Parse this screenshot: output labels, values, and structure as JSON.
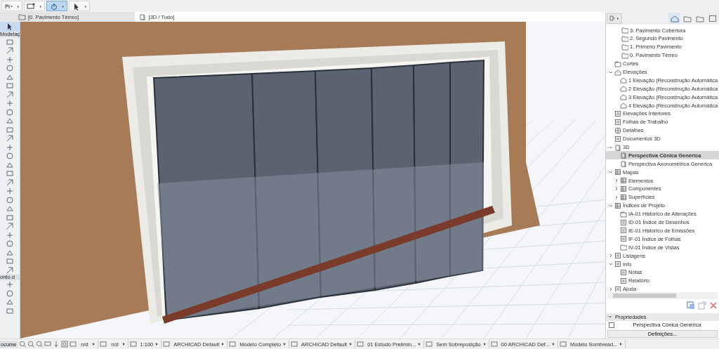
{
  "toolbar": {
    "buttons": [
      {
        "kind": "pet",
        "selected": false
      },
      {
        "kind": "layers",
        "selected": false
      },
      {
        "kind": "render",
        "selected": true
      },
      {
        "kind": "arrow",
        "selected": false
      }
    ]
  },
  "view_tabs": [
    {
      "label": "[0. Pavimento Térreo]",
      "kind": "plan",
      "selected": false
    },
    {
      "label": "[3D / Tudo]",
      "kind": "model",
      "selected": true
    }
  ],
  "toolbox": {
    "labels": [
      "Modelaç",
      "onto d"
    ]
  },
  "navigator": {
    "tree": [
      {
        "label": "3. Pavimento Cobertura",
        "kind": "story",
        "selected": false
      },
      {
        "label": "2. Segundo Pavimento",
        "kind": "story",
        "selected": false
      },
      {
        "label": "1. Primeiro Pavimento",
        "kind": "story",
        "selected": false
      },
      {
        "label": "0. Pavimento Térreo",
        "kind": "story",
        "selected": false
      },
      {
        "label": "Cortes",
        "kind": "section",
        "selected": false
      },
      {
        "label": "Elevações",
        "kind": "elevation",
        "selected": false,
        "expanded": true,
        "children": [
          {
            "label": "1 Elevação (Reconstrução Automática",
            "kind": "elevation",
            "selected": false
          },
          {
            "label": "2 Elevação (Reconstrução Automática",
            "kind": "elevation",
            "selected": false
          },
          {
            "label": "3 Elevação (Reconstrução Automática",
            "kind": "elevation",
            "selected": false
          },
          {
            "label": "4 Elevação (Reconstrução Automática",
            "kind": "elevation",
            "selected": false
          }
        ]
      },
      {
        "label": "Elevações Interiores",
        "kind": "sheet",
        "selected": false
      },
      {
        "label": "Folhas de Trabalho",
        "kind": "sheet",
        "selected": false
      },
      {
        "label": "Detalhes",
        "kind": "detail",
        "selected": false
      },
      {
        "label": "Documentos 3D",
        "kind": "sheet",
        "selected": false
      },
      {
        "label": "3D",
        "kind": "cube",
        "selected": false,
        "expanded": true,
        "children": [
          {
            "label": "Perspectiva Cônica Genérica",
            "kind": "cube",
            "selected": true
          },
          {
            "label": "Perspectiva Axonométrica Genérica",
            "kind": "cube",
            "selected": false
          }
        ]
      },
      {
        "label": "Mapas",
        "kind": "table",
        "selected": false,
        "expanded": true,
        "children": [
          {
            "label": "Elementos",
            "kind": "table",
            "selected": false,
            "expanded": false
          },
          {
            "label": "Componentes",
            "kind": "table",
            "selected": false,
            "expanded": false
          },
          {
            "label": "Superfícies",
            "kind": "table",
            "selected": false,
            "expanded": false
          }
        ]
      },
      {
        "label": "Índices de Projeto",
        "kind": "table",
        "selected": false,
        "expanded": true,
        "children": [
          {
            "label": "IA-01 Histórico de Alterações",
            "kind": "section",
            "selected": false
          },
          {
            "label": "ID-01 Índice de Desenhos",
            "kind": "sheet",
            "selected": false
          },
          {
            "label": "IE-01 Histórico de Emissões",
            "kind": "sheet",
            "selected": false
          },
          {
            "label": "IF-01 Índice de Folhas",
            "kind": "sheet",
            "selected": false
          },
          {
            "label": "IV-01 Índice de Vistas",
            "kind": "story",
            "selected": false
          }
        ]
      },
      {
        "label": "Listagens",
        "kind": "sheet",
        "selected": false,
        "expanded": false
      },
      {
        "label": "Info",
        "kind": "sheet",
        "selected": false,
        "expanded": true,
        "children": [
          {
            "label": "Notas",
            "kind": "sheet",
            "selected": false
          },
          {
            "label": "Relatório",
            "kind": "sheet",
            "selected": false
          }
        ]
      },
      {
        "label": "Ajuda",
        "kind": "sheet",
        "selected": false,
        "expanded": false
      }
    ]
  },
  "properties": {
    "header": "Propriedades",
    "item": "Perspectiva Cônica Genérica",
    "button": "Definições..."
  },
  "status_bar": [
    {
      "kind": "label",
      "text": "ocume"
    },
    {
      "kind": "value",
      "text": "n/d"
    },
    {
      "kind": "value",
      "text": "n/d"
    },
    {
      "kind": "value",
      "text": "1:100"
    },
    {
      "kind": "value",
      "text": "ARCHICAD Default"
    },
    {
      "kind": "value",
      "text": "Modelo Completo"
    },
    {
      "kind": "value",
      "text": "ARCHICAD Default"
    },
    {
      "kind": "value",
      "text": "01 Estudo Prelimin..."
    },
    {
      "kind": "value",
      "text": "Sem Sobreposição"
    },
    {
      "kind": "value",
      "text": "00 ARCHICAD Def..."
    },
    {
      "kind": "value",
      "text": "Modelo Sombread..."
    }
  ]
}
